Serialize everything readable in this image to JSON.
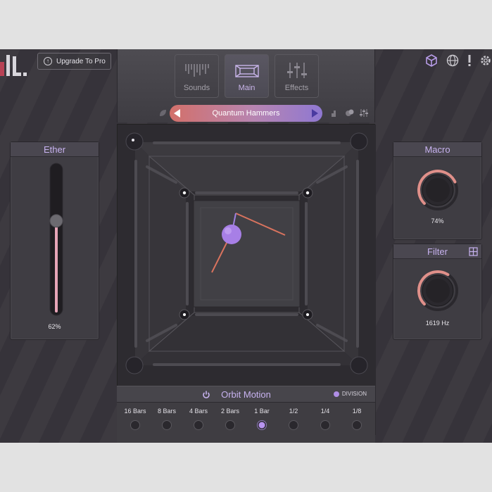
{
  "header": {
    "upgrade_label": "Upgrade To Pro",
    "tabs": [
      {
        "label": "Sounds",
        "icon": "waveform-icon",
        "active": false
      },
      {
        "label": "Main",
        "icon": "cube-outline-icon",
        "active": true
      },
      {
        "label": "Effects",
        "icon": "sliders-icon",
        "active": false
      }
    ],
    "preset_name": "Quantum Hammers",
    "top_icons": [
      "cube-icon",
      "globe-icon",
      "alert-icon",
      "gear-icon"
    ]
  },
  "ether": {
    "title": "Ether",
    "value_label": "62%",
    "value": 0.62
  },
  "macro": {
    "title": "Macro",
    "value_label": "74%",
    "value": 0.74
  },
  "filter": {
    "title": "Filter",
    "value_label": "1619 Hz",
    "value": 0.62
  },
  "motion": {
    "title": "Orbit Motion",
    "division_label": "DIVISION",
    "selected_index": 4,
    "rates": [
      "16 Bars",
      "8 Bars",
      "4 Bars",
      "2 Bars",
      "1 Bar",
      "1/2",
      "1/4",
      "1/8"
    ]
  },
  "colors": {
    "accent": "#c7b2ef",
    "preset_start": "#d3706a",
    "preset_end": "#8f78d2",
    "knob_arc": "#e0908a",
    "ball": "#a77fe6"
  }
}
